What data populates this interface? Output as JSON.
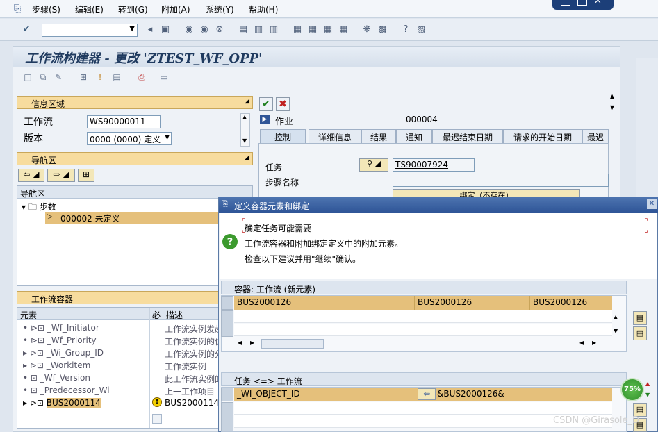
{
  "menu": {
    "items": [
      "步骤(S)",
      "编辑(E)",
      "转到(G)",
      "附加(A)",
      "系统(Y)",
      "帮助(H)"
    ]
  },
  "app": {
    "title": "工作流构建器 - 更改 'ZTEST_WF_OPP'"
  },
  "info_area": {
    "header": "信息区域",
    "workflow_label": "工作流",
    "workflow_value": "WS90000011",
    "version_label": "版本",
    "version_value": "0000 (0000) 定义"
  },
  "nav": {
    "header": "导航区",
    "list_header": "导航区",
    "root": "步数",
    "child": "000002 未定义"
  },
  "container": {
    "header": "工作流容器",
    "col_element": "元素",
    "col_flag": "必",
    "col_desc": "描述",
    "rows": [
      {
        "name": "_Wf_Initiator",
        "desc": "工作流实例发起"
      },
      {
        "name": "_Wf_Priority",
        "desc": "工作流实例的优"
      },
      {
        "name": "_Wi_Group_ID",
        "desc": "工作流实例的分"
      },
      {
        "name": "_Workitem",
        "desc": "工作流实例"
      },
      {
        "name": "_Wf_Version",
        "desc": "此工作流实例的"
      },
      {
        "name": "_Predecessor_Wi",
        "desc": "上一工作项目"
      },
      {
        "name": "BUS2000114",
        "desc": "BUS2000114"
      }
    ]
  },
  "detail": {
    "step_type": "作业",
    "step_number": "000004",
    "tabs": [
      "控制",
      "详细信息",
      "结果",
      "通知",
      "最迟结束日期",
      "请求的开始日期",
      "最迟"
    ],
    "task_label": "任务",
    "task_value": "TS90007924",
    "step_name_label": "步骤名称",
    "binding_button": "绑定（不存在）"
  },
  "dialog": {
    "title": "定义容器元素和绑定",
    "message_line1": "确定任务可能需要",
    "message_line2": "工作流容器和附加绑定定义中的附加元素。",
    "message_line3": "检查以下建议并用\"继续\"确认。",
    "table1_header": "容器: 工作流 (新元素)",
    "table1_row": [
      "BUS2000126",
      "BUS2000126",
      "BUS2000126"
    ],
    "table2_header": "任务 <=> 工作流",
    "table2_row": [
      "_WI_OBJECT_ID",
      "&BUS2000126&"
    ],
    "progress_label": "75%"
  },
  "watermark": "CSDN @Girasole_D",
  "colors": {
    "selection": "#e5c07b",
    "section_header": "#f7dc9e",
    "dialog_title": "#2f5597"
  }
}
